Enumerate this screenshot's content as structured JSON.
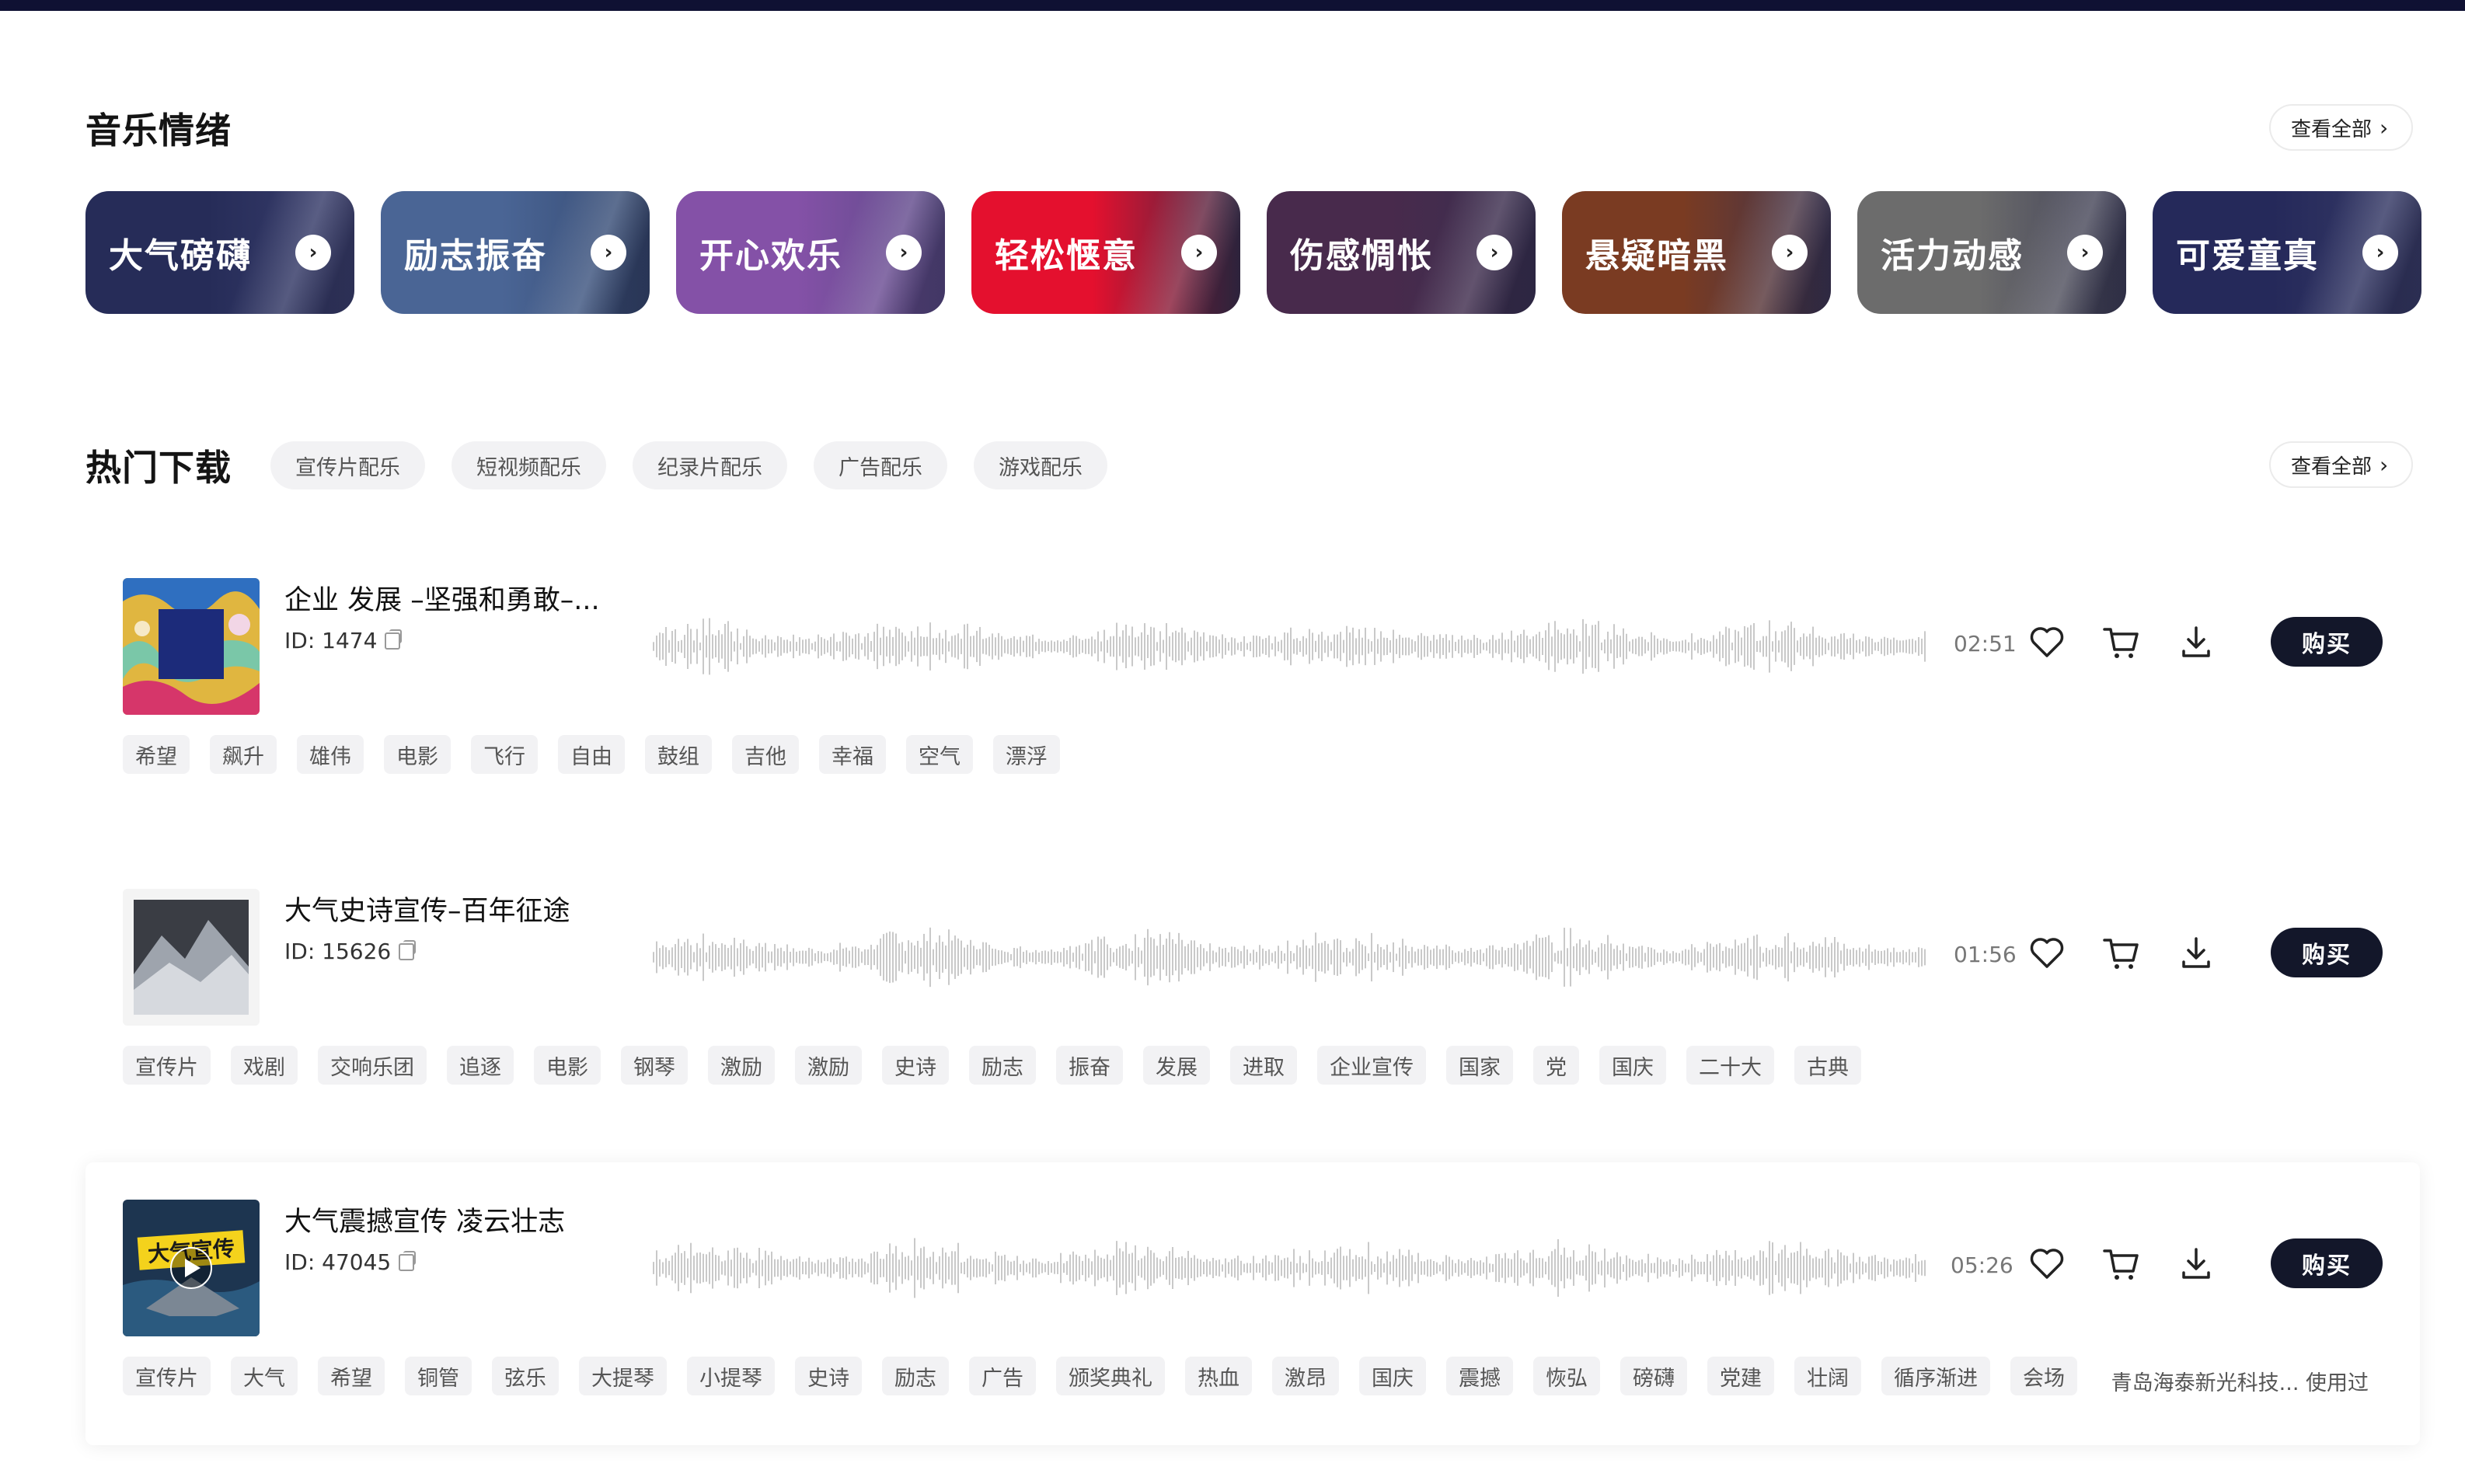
{
  "moods_section": {
    "title": "音乐情绪",
    "view_all": "查看全部",
    "items": [
      {
        "label": "大气磅礴",
        "color": "#262c58",
        "color2": "#3a3f6e"
      },
      {
        "label": "励志振奋",
        "color": "#4a6595",
        "color2": "#34486f"
      },
      {
        "label": "开心欢乐",
        "color": "#8451a7",
        "color2": "#5a4a86"
      },
      {
        "label": "轻松惬意",
        "color": "#e4102e",
        "color2": "#3a2b46"
      },
      {
        "label": "伤感惆怅",
        "color": "#482a4c",
        "color2": "#3a3050"
      },
      {
        "label": "悬疑暗黑",
        "color": "#7a3b22",
        "color2": "#3c3450"
      },
      {
        "label": "活力动感",
        "color": "#6c6c6c",
        "color2": "#3d3d55"
      },
      {
        "label": "可爱童真",
        "color": "#25295a",
        "color2": "#383c68"
      }
    ]
  },
  "hot_section": {
    "title": "热门下载",
    "view_all": "查看全部",
    "filters": [
      "宣传片配乐",
      "短视频配乐",
      "纪录片配乐",
      "广告配乐",
      "游戏配乐"
    ]
  },
  "tracks": [
    {
      "title": "企业 发展 –坚强和勇敢–...",
      "id_text": "ID: 1474",
      "duration": "02:51",
      "buy_label": "购买",
      "tags": [
        "希望",
        "飙升",
        "雄伟",
        "电影",
        "飞行",
        "自由",
        "鼓组",
        "吉他",
        "幸福",
        "空气",
        "漂浮"
      ]
    },
    {
      "title": "大气史诗宣传–百年征途",
      "id_text": "ID: 15626",
      "duration": "01:56",
      "buy_label": "购买",
      "tags": [
        "宣传片",
        "戏剧",
        "交响乐团",
        "追逐",
        "电影",
        "钢琴",
        "激励",
        "激励",
        "史诗",
        "励志",
        "振奋",
        "发展",
        "进取",
        "企业宣传",
        "国家",
        "党",
        "国庆",
        "二十大",
        "古典"
      ]
    },
    {
      "title": "大气震撼宣传 凌云壮志",
      "id_text": "ID: 47045",
      "duration": "05:26",
      "buy_label": "购买",
      "vendor": "青岛海泰新光科技... 使用过",
      "cover_banner": "大气宣传",
      "tags": [
        "宣传片",
        "大气",
        "希望",
        "铜管",
        "弦乐",
        "大提琴",
        "小提琴",
        "史诗",
        "励志",
        "广告",
        "颁奖典礼",
        "热血",
        "激昂",
        "国庆",
        "震撼",
        "恢弘",
        "磅礴",
        "党建",
        "壮阔",
        "循序渐进",
        "会场"
      ]
    }
  ]
}
